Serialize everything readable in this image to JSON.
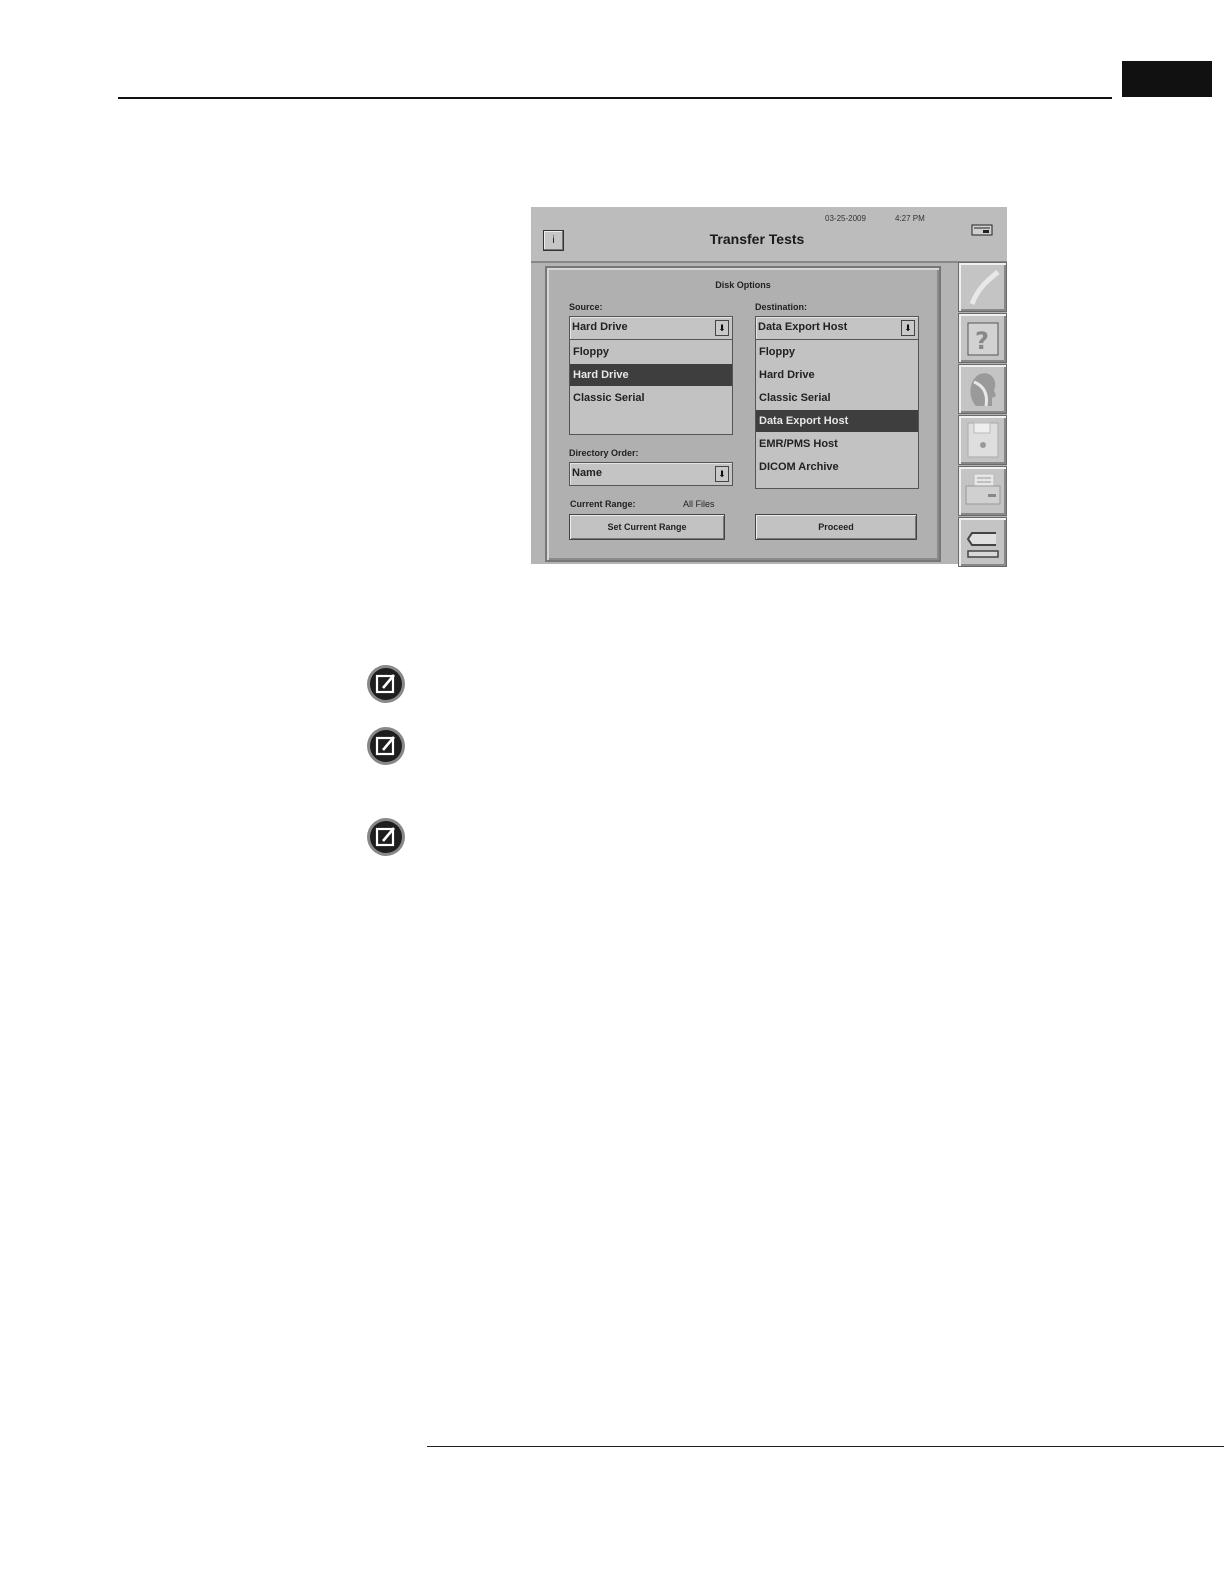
{
  "window": {
    "title": "Transfer Tests",
    "date": "03-25-2009",
    "time": "4:27 PM",
    "info_button": "i"
  },
  "panel": {
    "title": "Disk Options",
    "source": {
      "label": "Source:",
      "selected": "Hard Drive",
      "options": [
        "Floppy",
        "Hard Drive",
        "Classic Serial"
      ],
      "highlighted": "Hard Drive"
    },
    "destination": {
      "label": "Destination:",
      "selected": "Data Export Host",
      "options": [
        "Floppy",
        "Hard Drive",
        "Classic Serial",
        "Data Export Host",
        "EMR/PMS Host",
        "DICOM Archive"
      ],
      "highlighted": "Data Export Host"
    },
    "directory_order": {
      "label": "Directory Order:",
      "selected": "Name"
    },
    "current_range": {
      "label": "Current Range:",
      "value": "All Files"
    },
    "buttons": {
      "set_range": "Set Current Range",
      "proceed": "Proceed"
    }
  },
  "sidebar": {
    "icons": [
      "curve-icon",
      "help-icon",
      "head-icon",
      "floppy-disk-icon",
      "printer-icon",
      "return-arrow-icon"
    ]
  },
  "notes": {
    "icons": [
      "note-icon",
      "note-icon",
      "note-icon"
    ]
  }
}
